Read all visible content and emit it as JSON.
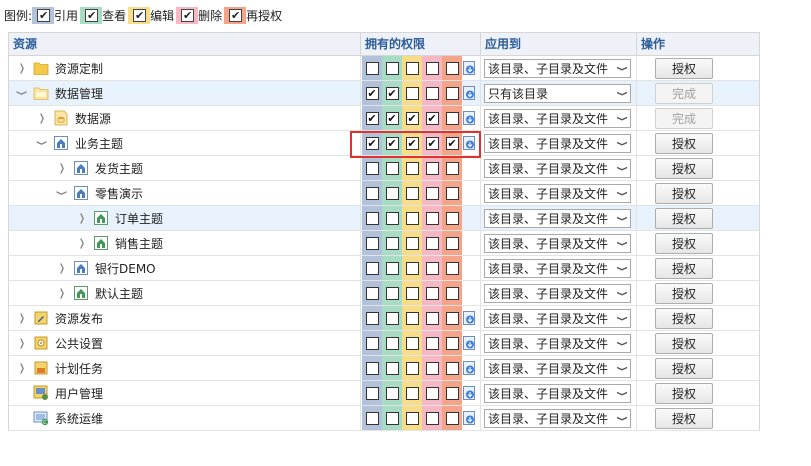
{
  "legend": {
    "label": "图例:",
    "items": [
      {
        "label": "引用",
        "color": "#b3c2db"
      },
      {
        "label": "查看",
        "color": "#a8dcc4"
      },
      {
        "label": "编辑",
        "color": "#f7dc8a"
      },
      {
        "label": "删除",
        "color": "#f5b8c4"
      },
      {
        "label": "再授权",
        "color": "#f4a589"
      }
    ]
  },
  "header": {
    "resource": "资源",
    "perms": "拥有的权限",
    "apply": "应用到",
    "op": "操作"
  },
  "perm_colors": [
    "#b3c2db",
    "#a8dcc4",
    "#f7dc8a",
    "#f5b8c4",
    "#f4a589"
  ],
  "rows": [
    {
      "name": "资源定制",
      "icon": "folder-icon",
      "checks": [
        false,
        false,
        false,
        false,
        false
      ],
      "apply": "该目录、子目录及文件",
      "action": "授权",
      "disabled": false,
      "inherit": true
    },
    {
      "name": "数据管理",
      "icon": "data-folder-icon",
      "checks": [
        true,
        true,
        false,
        false,
        false
      ],
      "apply": "只有该目录",
      "action": "完成",
      "disabled": true,
      "inherit": true
    },
    {
      "name": "数据源",
      "icon": "datasource-icon",
      "checks": [
        true,
        true,
        true,
        true,
        false
      ],
      "apply": "该目录、子目录及文件",
      "action": "完成",
      "disabled": true,
      "inherit": true
    },
    {
      "name": "业务主题",
      "icon": "subject-icon",
      "checks": [
        true,
        true,
        true,
        true,
        true
      ],
      "apply": "该目录、子目录及文件",
      "action": "授权",
      "disabled": false,
      "inherit": true
    },
    {
      "name": "发货主题",
      "icon": "subject-icon",
      "checks": [
        false,
        false,
        false,
        false,
        false
      ],
      "apply": "该目录、子目录及文件",
      "action": "授权",
      "disabled": false,
      "inherit": false
    },
    {
      "name": "零售演示",
      "icon": "subject-icon",
      "checks": [
        false,
        false,
        false,
        false,
        false
      ],
      "apply": "该目录、子目录及文件",
      "action": "授权",
      "disabled": false,
      "inherit": false
    },
    {
      "name": "订单主题",
      "icon": "subject-green-icon",
      "checks": [
        false,
        false,
        false,
        false,
        false
      ],
      "apply": "该目录、子目录及文件",
      "action": "授权",
      "disabled": false,
      "inherit": false
    },
    {
      "name": "销售主题",
      "icon": "subject-green-icon",
      "checks": [
        false,
        false,
        false,
        false,
        false
      ],
      "apply": "该目录、子目录及文件",
      "action": "授权",
      "disabled": false,
      "inherit": false
    },
    {
      "name": "银行DEMO",
      "icon": "subject-icon",
      "checks": [
        false,
        false,
        false,
        false,
        false
      ],
      "apply": "该目录、子目录及文件",
      "action": "授权",
      "disabled": false,
      "inherit": false
    },
    {
      "name": "默认主题",
      "icon": "subject-green-icon",
      "checks": [
        false,
        false,
        false,
        false,
        false
      ],
      "apply": "该目录、子目录及文件",
      "action": "授权",
      "disabled": false,
      "inherit": false
    },
    {
      "name": "资源发布",
      "icon": "publish-icon",
      "checks": [
        false,
        false,
        false,
        false,
        false
      ],
      "apply": "该目录、子目录及文件",
      "action": "授权",
      "disabled": false,
      "inherit": true
    },
    {
      "name": "公共设置",
      "icon": "settings-icon",
      "checks": [
        false,
        false,
        false,
        false,
        false
      ],
      "apply": "该目录、子目录及文件",
      "action": "授权",
      "disabled": false,
      "inherit": true
    },
    {
      "name": "计划任务",
      "icon": "schedule-icon",
      "checks": [
        false,
        false,
        false,
        false,
        false
      ],
      "apply": "该目录、子目录及文件",
      "action": "授权",
      "disabled": false,
      "inherit": true
    },
    {
      "name": "用户管理",
      "icon": "user-manage-icon",
      "checks": [
        false,
        false,
        false,
        false,
        false
      ],
      "apply": "该目录、子目录及文件",
      "action": "授权",
      "disabled": false,
      "inherit": true
    },
    {
      "name": "系统运维",
      "icon": "system-ops-icon",
      "checks": [
        false,
        false,
        false,
        false,
        false
      ],
      "apply": "该目录、子目录及文件",
      "action": "授权",
      "disabled": false,
      "inherit": true
    }
  ]
}
